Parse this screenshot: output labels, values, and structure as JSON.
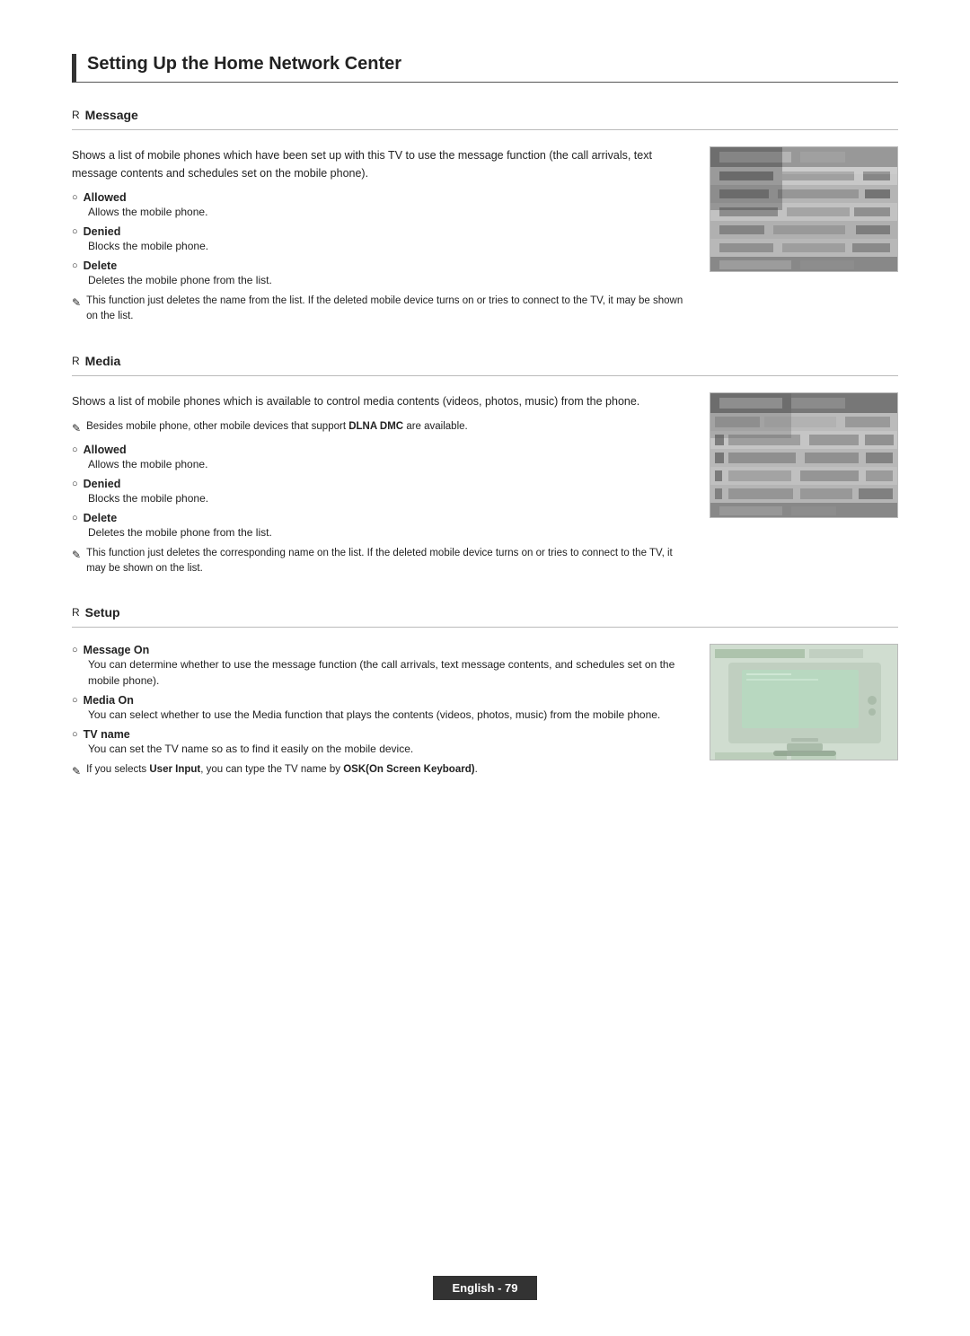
{
  "page": {
    "title": "Setting Up the Home Network Center",
    "footer": "English - 79"
  },
  "sections": [
    {
      "id": "message",
      "marker": "R",
      "heading": "Message",
      "description": "Shows a list of mobile phones which have been set up with this TV to use the message function (the call arrivals, text message contents and schedules set on the mobile phone).",
      "options": [
        {
          "label": "Allowed",
          "description": "Allows the mobile phone."
        },
        {
          "label": "Denied",
          "description": "Blocks the mobile phone."
        },
        {
          "label": "Delete",
          "description": "Deletes the mobile phone from the list."
        }
      ],
      "note": "This function just deletes the name from the list. If the deleted mobile device turns on or tries to connect to the TV, it may be shown on the list.",
      "has_image": true,
      "image_type": "pixel1"
    },
    {
      "id": "media",
      "marker": "R",
      "heading": "Media",
      "description": "Shows a list of mobile phones which is available to control media contents (videos, photos, music) from the phone.",
      "extra_note": "Besides mobile phone, other mobile devices that support DLNA DMC are available.",
      "options": [
        {
          "label": "Allowed",
          "description": "Allows the mobile phone."
        },
        {
          "label": "Denied",
          "description": "Blocks the mobile phone."
        },
        {
          "label": "Delete",
          "description": "Deletes the mobile phone from the list."
        }
      ],
      "note": "This function just deletes the corresponding name on the list. If the deleted mobile device turns on or tries to connect to the TV, it may be shown on the list.",
      "has_image": true,
      "image_type": "pixel2"
    },
    {
      "id": "setup",
      "marker": "R",
      "heading": "Setup",
      "options_special": [
        {
          "label": "Message On",
          "description": "You can determine whether to use the message function (the call arrivals, text message contents, and schedules set on the mobile phone)."
        },
        {
          "label": "Media On",
          "description": "You can select whether to use the Media function that plays the contents (videos, photos, music) from the mobile phone."
        },
        {
          "label": "TV name",
          "description": "You can set the TV name so as to find it easily on the mobile device."
        }
      ],
      "note": "If you selects User Input, you can type the TV name by OSK(On Screen Keyboard).",
      "has_image": true,
      "image_type": "tv"
    }
  ]
}
